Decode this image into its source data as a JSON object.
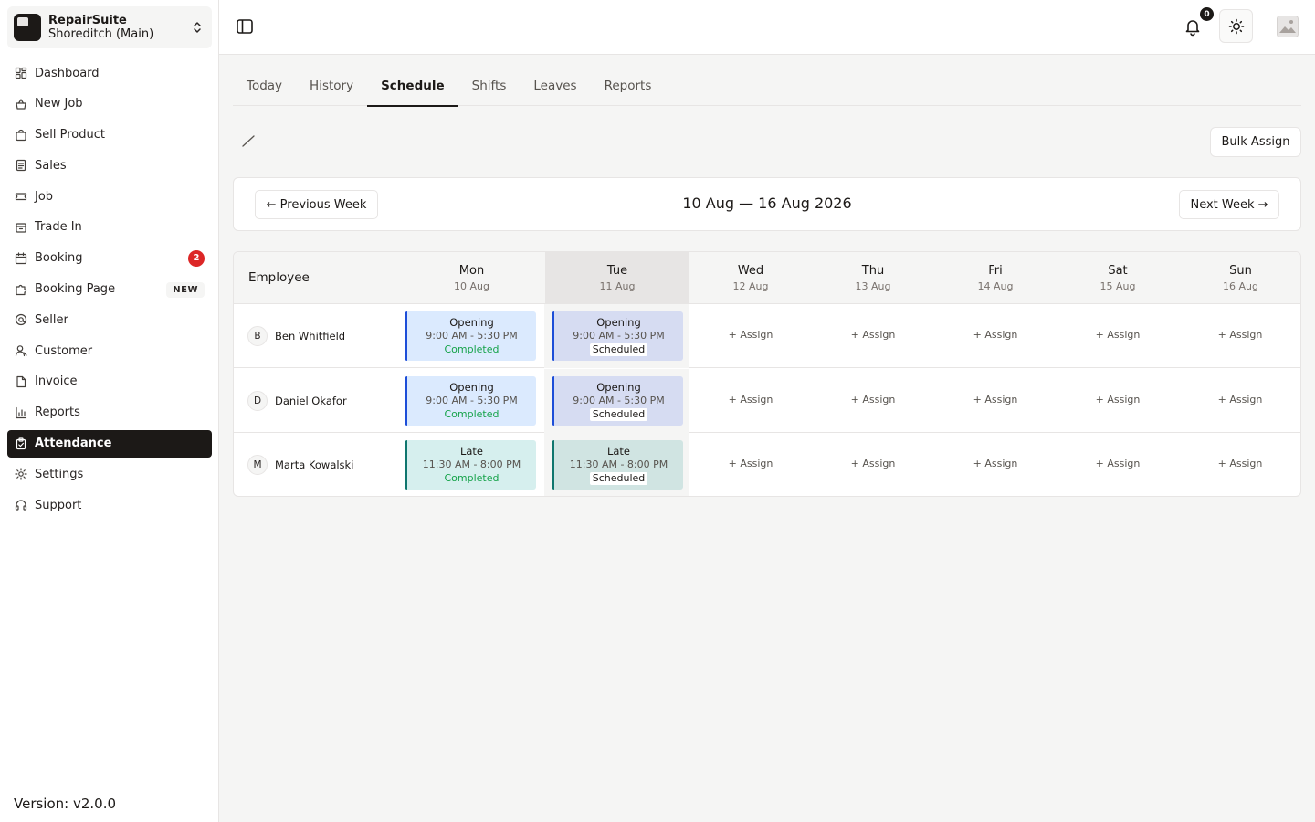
{
  "store": {
    "name": "RepairSuite",
    "branch": "Shoreditch (Main)"
  },
  "nav": [
    {
      "label": "Dashboard",
      "icon": "grid-icon"
    },
    {
      "label": "New Job",
      "icon": "basket-icon"
    },
    {
      "label": "Sell Product",
      "icon": "bag-icon"
    },
    {
      "label": "Sales",
      "icon": "receipt-icon"
    },
    {
      "label": "Job",
      "icon": "ticket-icon"
    },
    {
      "label": "Trade In",
      "icon": "box-icon"
    },
    {
      "label": "Booking",
      "icon": "calendar-icon",
      "badge": "2"
    },
    {
      "label": "Booking Page",
      "icon": "puzzle-icon",
      "tag": "NEW"
    },
    {
      "label": "Seller",
      "icon": "at-icon"
    },
    {
      "label": "Customer",
      "icon": "user-icon"
    },
    {
      "label": "Invoice",
      "icon": "file-icon"
    },
    {
      "label": "Reports",
      "icon": "chart-icon"
    },
    {
      "label": "Attendance",
      "icon": "clipboard-icon",
      "active": true
    },
    {
      "label": "Settings",
      "icon": "gear-icon"
    },
    {
      "label": "Support",
      "icon": "headset-icon"
    }
  ],
  "version": "Version: v2.0.0",
  "header": {
    "notification_count": "0"
  },
  "tabs": [
    {
      "label": "Today"
    },
    {
      "label": "History"
    },
    {
      "label": "Schedule",
      "active": true
    },
    {
      "label": "Shifts"
    },
    {
      "label": "Leaves"
    },
    {
      "label": "Reports"
    }
  ],
  "toolbar": {
    "bulk_assign_label": "Bulk Assign"
  },
  "week": {
    "prev_label": "← Previous Week",
    "next_label": "Next Week →",
    "range": "10 Aug — 16 Aug 2026"
  },
  "schedule": {
    "employee_header": "Employee",
    "days": [
      {
        "name": "Mon",
        "date": "10 Aug"
      },
      {
        "name": "Tue",
        "date": "11 Aug",
        "today": true
      },
      {
        "name": "Wed",
        "date": "12 Aug"
      },
      {
        "name": "Thu",
        "date": "13 Aug"
      },
      {
        "name": "Fri",
        "date": "14 Aug"
      },
      {
        "name": "Sat",
        "date": "15 Aug"
      },
      {
        "name": "Sun",
        "date": "16 Aug"
      }
    ],
    "assign_label": "+ Assign",
    "rows": [
      {
        "initial": "B",
        "name": "Ben Whitfield",
        "shifts": [
          {
            "name": "Opening",
            "time": "9:00 AM - 5:30 PM",
            "status": "Completed",
            "color": "blue"
          },
          {
            "name": "Opening",
            "time": "9:00 AM - 5:30 PM",
            "status": "Scheduled",
            "color": "blue"
          }
        ]
      },
      {
        "initial": "D",
        "name": "Daniel Okafor",
        "shifts": [
          {
            "name": "Opening",
            "time": "9:00 AM - 5:30 PM",
            "status": "Completed",
            "color": "blue"
          },
          {
            "name": "Opening",
            "time": "9:00 AM - 5:30 PM",
            "status": "Scheduled",
            "color": "blue"
          }
        ]
      },
      {
        "initial": "M",
        "name": "Marta Kowalski",
        "shifts": [
          {
            "name": "Late",
            "time": "11:30 AM - 8:00 PM",
            "status": "Completed",
            "color": "teal"
          },
          {
            "name": "Late",
            "time": "11:30 AM - 8:00 PM",
            "status": "Scheduled",
            "color": "teal"
          }
        ]
      }
    ]
  }
}
